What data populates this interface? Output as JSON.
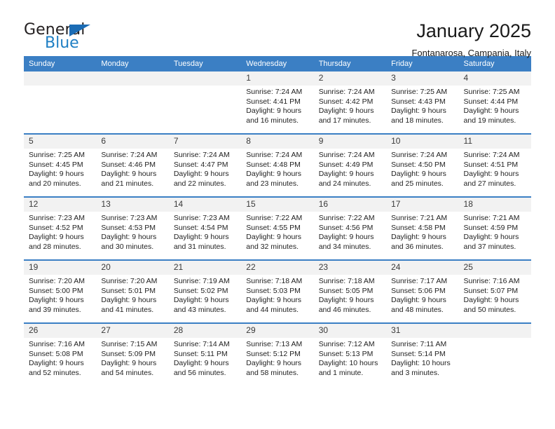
{
  "brand": {
    "name_part1": "General",
    "name_part2": "Blue",
    "triangle_color": "#1b6cb5",
    "blue_color": "#1f7fc4"
  },
  "header": {
    "title": "January 2025",
    "subtitle": "Fontanarosa, Campania, Italy"
  },
  "colors": {
    "header_blue": "#3b7fc4",
    "daynum_bg": "#f2f2f2",
    "text": "#1f1f1f"
  },
  "weekday_headers": [
    "Sunday",
    "Monday",
    "Tuesday",
    "Wednesday",
    "Thursday",
    "Friday",
    "Saturday"
  ],
  "weeks": [
    [
      {
        "day": "",
        "empty": true,
        "lines": []
      },
      {
        "day": "",
        "empty": true,
        "lines": []
      },
      {
        "day": "",
        "empty": true,
        "lines": []
      },
      {
        "day": "1",
        "empty": false,
        "lines": [
          "Sunrise: 7:24 AM",
          "Sunset: 4:41 PM",
          "Daylight: 9 hours",
          "and 16 minutes."
        ]
      },
      {
        "day": "2",
        "empty": false,
        "lines": [
          "Sunrise: 7:24 AM",
          "Sunset: 4:42 PM",
          "Daylight: 9 hours",
          "and 17 minutes."
        ]
      },
      {
        "day": "3",
        "empty": false,
        "lines": [
          "Sunrise: 7:25 AM",
          "Sunset: 4:43 PM",
          "Daylight: 9 hours",
          "and 18 minutes."
        ]
      },
      {
        "day": "4",
        "empty": false,
        "lines": [
          "Sunrise: 7:25 AM",
          "Sunset: 4:44 PM",
          "Daylight: 9 hours",
          "and 19 minutes."
        ]
      }
    ],
    [
      {
        "day": "5",
        "empty": false,
        "lines": [
          "Sunrise: 7:25 AM",
          "Sunset: 4:45 PM",
          "Daylight: 9 hours",
          "and 20 minutes."
        ]
      },
      {
        "day": "6",
        "empty": false,
        "lines": [
          "Sunrise: 7:24 AM",
          "Sunset: 4:46 PM",
          "Daylight: 9 hours",
          "and 21 minutes."
        ]
      },
      {
        "day": "7",
        "empty": false,
        "lines": [
          "Sunrise: 7:24 AM",
          "Sunset: 4:47 PM",
          "Daylight: 9 hours",
          "and 22 minutes."
        ]
      },
      {
        "day": "8",
        "empty": false,
        "lines": [
          "Sunrise: 7:24 AM",
          "Sunset: 4:48 PM",
          "Daylight: 9 hours",
          "and 23 minutes."
        ]
      },
      {
        "day": "9",
        "empty": false,
        "lines": [
          "Sunrise: 7:24 AM",
          "Sunset: 4:49 PM",
          "Daylight: 9 hours",
          "and 24 minutes."
        ]
      },
      {
        "day": "10",
        "empty": false,
        "lines": [
          "Sunrise: 7:24 AM",
          "Sunset: 4:50 PM",
          "Daylight: 9 hours",
          "and 25 minutes."
        ]
      },
      {
        "day": "11",
        "empty": false,
        "lines": [
          "Sunrise: 7:24 AM",
          "Sunset: 4:51 PM",
          "Daylight: 9 hours",
          "and 27 minutes."
        ]
      }
    ],
    [
      {
        "day": "12",
        "empty": false,
        "lines": [
          "Sunrise: 7:23 AM",
          "Sunset: 4:52 PM",
          "Daylight: 9 hours",
          "and 28 minutes."
        ]
      },
      {
        "day": "13",
        "empty": false,
        "lines": [
          "Sunrise: 7:23 AM",
          "Sunset: 4:53 PM",
          "Daylight: 9 hours",
          "and 30 minutes."
        ]
      },
      {
        "day": "14",
        "empty": false,
        "lines": [
          "Sunrise: 7:23 AM",
          "Sunset: 4:54 PM",
          "Daylight: 9 hours",
          "and 31 minutes."
        ]
      },
      {
        "day": "15",
        "empty": false,
        "lines": [
          "Sunrise: 7:22 AM",
          "Sunset: 4:55 PM",
          "Daylight: 9 hours",
          "and 32 minutes."
        ]
      },
      {
        "day": "16",
        "empty": false,
        "lines": [
          "Sunrise: 7:22 AM",
          "Sunset: 4:56 PM",
          "Daylight: 9 hours",
          "and 34 minutes."
        ]
      },
      {
        "day": "17",
        "empty": false,
        "lines": [
          "Sunrise: 7:21 AM",
          "Sunset: 4:58 PM",
          "Daylight: 9 hours",
          "and 36 minutes."
        ]
      },
      {
        "day": "18",
        "empty": false,
        "lines": [
          "Sunrise: 7:21 AM",
          "Sunset: 4:59 PM",
          "Daylight: 9 hours",
          "and 37 minutes."
        ]
      }
    ],
    [
      {
        "day": "19",
        "empty": false,
        "lines": [
          "Sunrise: 7:20 AM",
          "Sunset: 5:00 PM",
          "Daylight: 9 hours",
          "and 39 minutes."
        ]
      },
      {
        "day": "20",
        "empty": false,
        "lines": [
          "Sunrise: 7:20 AM",
          "Sunset: 5:01 PM",
          "Daylight: 9 hours",
          "and 41 minutes."
        ]
      },
      {
        "day": "21",
        "empty": false,
        "lines": [
          "Sunrise: 7:19 AM",
          "Sunset: 5:02 PM",
          "Daylight: 9 hours",
          "and 43 minutes."
        ]
      },
      {
        "day": "22",
        "empty": false,
        "lines": [
          "Sunrise: 7:18 AM",
          "Sunset: 5:03 PM",
          "Daylight: 9 hours",
          "and 44 minutes."
        ]
      },
      {
        "day": "23",
        "empty": false,
        "lines": [
          "Sunrise: 7:18 AM",
          "Sunset: 5:05 PM",
          "Daylight: 9 hours",
          "and 46 minutes."
        ]
      },
      {
        "day": "24",
        "empty": false,
        "lines": [
          "Sunrise: 7:17 AM",
          "Sunset: 5:06 PM",
          "Daylight: 9 hours",
          "and 48 minutes."
        ]
      },
      {
        "day": "25",
        "empty": false,
        "lines": [
          "Sunrise: 7:16 AM",
          "Sunset: 5:07 PM",
          "Daylight: 9 hours",
          "and 50 minutes."
        ]
      }
    ],
    [
      {
        "day": "26",
        "empty": false,
        "lines": [
          "Sunrise: 7:16 AM",
          "Sunset: 5:08 PM",
          "Daylight: 9 hours",
          "and 52 minutes."
        ]
      },
      {
        "day": "27",
        "empty": false,
        "lines": [
          "Sunrise: 7:15 AM",
          "Sunset: 5:09 PM",
          "Daylight: 9 hours",
          "and 54 minutes."
        ]
      },
      {
        "day": "28",
        "empty": false,
        "lines": [
          "Sunrise: 7:14 AM",
          "Sunset: 5:11 PM",
          "Daylight: 9 hours",
          "and 56 minutes."
        ]
      },
      {
        "day": "29",
        "empty": false,
        "lines": [
          "Sunrise: 7:13 AM",
          "Sunset: 5:12 PM",
          "Daylight: 9 hours",
          "and 58 minutes."
        ]
      },
      {
        "day": "30",
        "empty": false,
        "lines": [
          "Sunrise: 7:12 AM",
          "Sunset: 5:13 PM",
          "Daylight: 10 hours",
          "and 1 minute."
        ]
      },
      {
        "day": "31",
        "empty": false,
        "lines": [
          "Sunrise: 7:11 AM",
          "Sunset: 5:14 PM",
          "Daylight: 10 hours",
          "and 3 minutes."
        ]
      },
      {
        "day": "",
        "empty": true,
        "lines": []
      }
    ]
  ]
}
